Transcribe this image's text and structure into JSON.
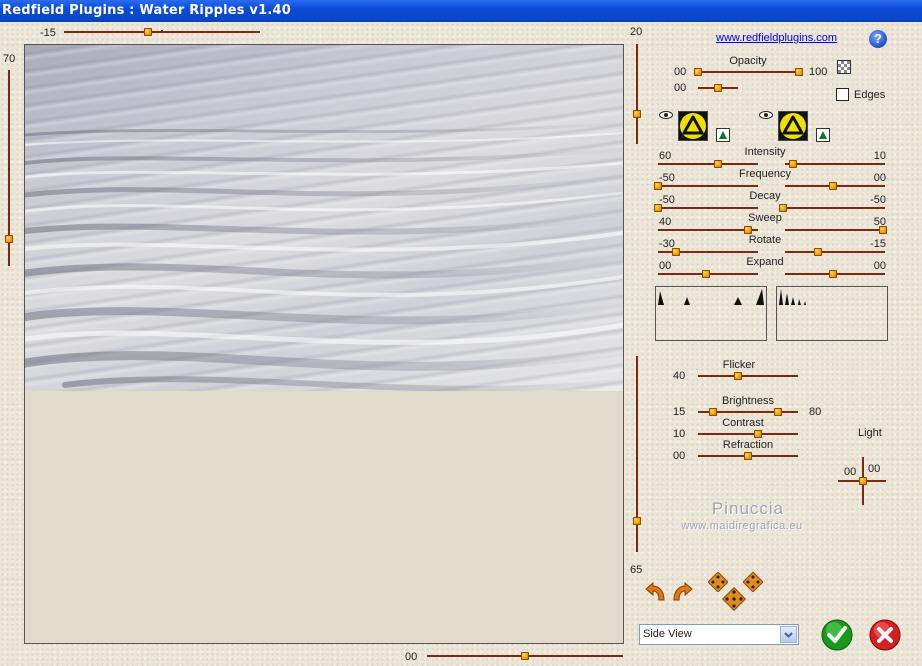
{
  "window": {
    "title": "Redfield Plugins : Water Ripples v1.40"
  },
  "website_link": "www.redfieldplugins.com",
  "help_icon": "question-mark-icon",
  "top_slider": {
    "value": "-15"
  },
  "left_slider": {
    "value": "70"
  },
  "right_top_slider": {
    "value": "20"
  },
  "right_bottom_slider": {
    "value": "65"
  },
  "bottom_slider": {
    "value": "00"
  },
  "opacity": {
    "label": "Opacity",
    "min": "00",
    "max": "100",
    "second": "00"
  },
  "edges": {
    "label": "Edges",
    "checked": false
  },
  "params": [
    {
      "name": "Intensity",
      "left": "60",
      "right": "10"
    },
    {
      "name": "Frequency",
      "left": "-50",
      "right": "00"
    },
    {
      "name": "Decay",
      "left": "-50",
      "right": "-50"
    },
    {
      "name": "Sweep",
      "left": "40",
      "right": "50"
    },
    {
      "name": "Rotate",
      "left": "-30",
      "right": "-15"
    },
    {
      "name": "Expand",
      "left": "00",
      "right": "00"
    }
  ],
  "lighting": {
    "flicker": {
      "label": "Flicker",
      "value": "40"
    },
    "brightness": {
      "label": "Brightness",
      "value": "15",
      "right": "80"
    },
    "contrast": {
      "label": "Contrast",
      "value": "10"
    },
    "refraction": {
      "label": "Refraction",
      "value": "00"
    },
    "light": {
      "label": "Light",
      "x": "00",
      "y": "00"
    }
  },
  "watermark": {
    "name": "Pinuccia",
    "site": "www.maidiregrafica.eu"
  },
  "view_select": {
    "value": "Side View"
  },
  "colors": {
    "title_bar": "#0a4bd8",
    "track": "#7b2a12",
    "thumb": "#f09a00",
    "ok": "#1a9a1a",
    "cancel": "#d42020"
  }
}
